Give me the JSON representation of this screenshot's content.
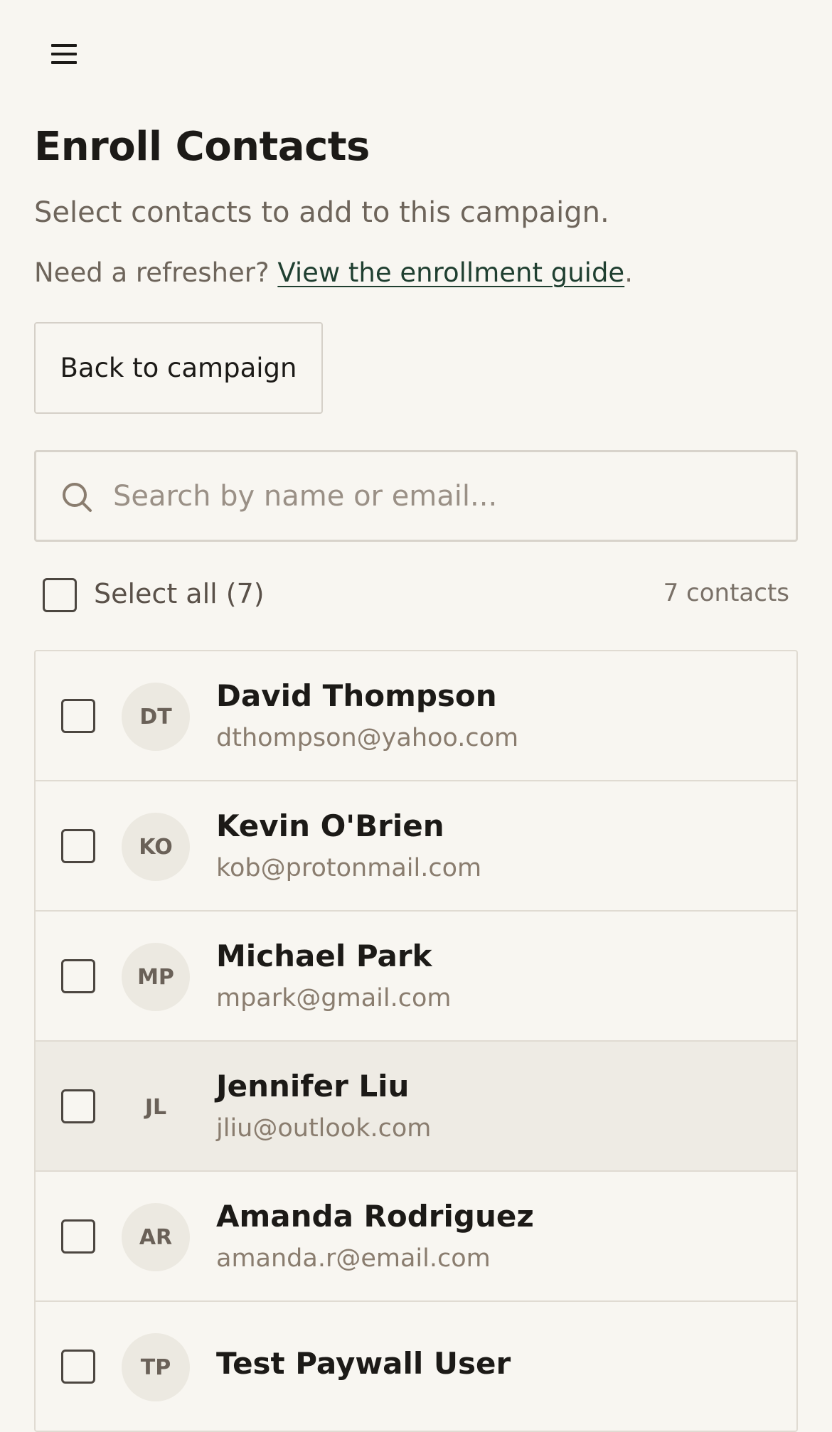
{
  "header": {
    "menu_icon": "hamburger-menu-icon"
  },
  "page": {
    "title": "Enroll Contacts",
    "subtitle": "Select contacts to add to this campaign.",
    "refresher_prefix": "Need a refresher? ",
    "guide_link": "View the enrollment guide",
    "refresher_suffix": "."
  },
  "actions": {
    "back_label": "Back to campaign"
  },
  "search": {
    "icon": "search-icon",
    "placeholder": "Search by name or email...",
    "value": ""
  },
  "selection": {
    "select_all_label": "Select all (7)",
    "count_label": "7 contacts",
    "select_all_checked": false
  },
  "contacts": [
    {
      "initials": "DT",
      "name": "David Thompson",
      "email": "dthompson@yahoo.com",
      "checked": false,
      "highlighted": false
    },
    {
      "initials": "KO",
      "name": "Kevin O'Brien",
      "email": "kob@protonmail.com",
      "checked": false,
      "highlighted": false
    },
    {
      "initials": "MP",
      "name": "Michael Park",
      "email": "mpark@gmail.com",
      "checked": false,
      "highlighted": false
    },
    {
      "initials": "JL",
      "name": "Jennifer Liu",
      "email": "jliu@outlook.com",
      "checked": false,
      "highlighted": true
    },
    {
      "initials": "AR",
      "name": "Amanda Rodriguez",
      "email": "amanda.r@email.com",
      "checked": false,
      "highlighted": false
    },
    {
      "initials": "TP",
      "name": "Test Paywall User",
      "email": "",
      "checked": false,
      "highlighted": false
    }
  ],
  "colors": {
    "background": "#f8f6f1",
    "text_primary": "#1c1a17",
    "text_muted": "#6e655b",
    "link": "#1f3f30",
    "border": "#e0dbd2",
    "row_highlight": "#eeebe4",
    "avatar_bg": "#ece9e1"
  }
}
